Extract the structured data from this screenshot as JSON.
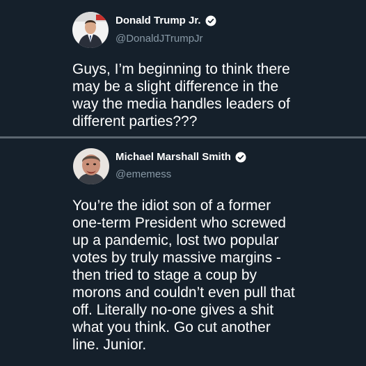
{
  "tweets": [
    {
      "name": "Donald Trump Jr.",
      "handle": "@DonaldJTrumpJr",
      "verified": true,
      "lines": [
        "Guys, I’m beginning to think there",
        "may be a slight difference in the",
        "way the media handles leaders of",
        "different parties???"
      ]
    },
    {
      "name": "Michael Marshall Smith",
      "handle": "@ememess",
      "verified": true,
      "lines": [
        "You’re the idiot son of a former",
        "one-term President who screwed",
        "up a pandemic, lost two popular",
        "votes by truly massive margins -",
        "then tried to stage a coup by",
        "morons and couldn’t even pull that",
        "off. Literally no-one gives a shit",
        "what you think. Go cut another",
        "line. Junior."
      ]
    }
  ],
  "colors": {
    "background": "#15202b",
    "text": "#ffffff",
    "secondary_text": "#8899a6",
    "divider": "#5b6670",
    "verified_badge": "#ffffff"
  },
  "icons": {
    "verified": "verified-badge-icon"
  }
}
